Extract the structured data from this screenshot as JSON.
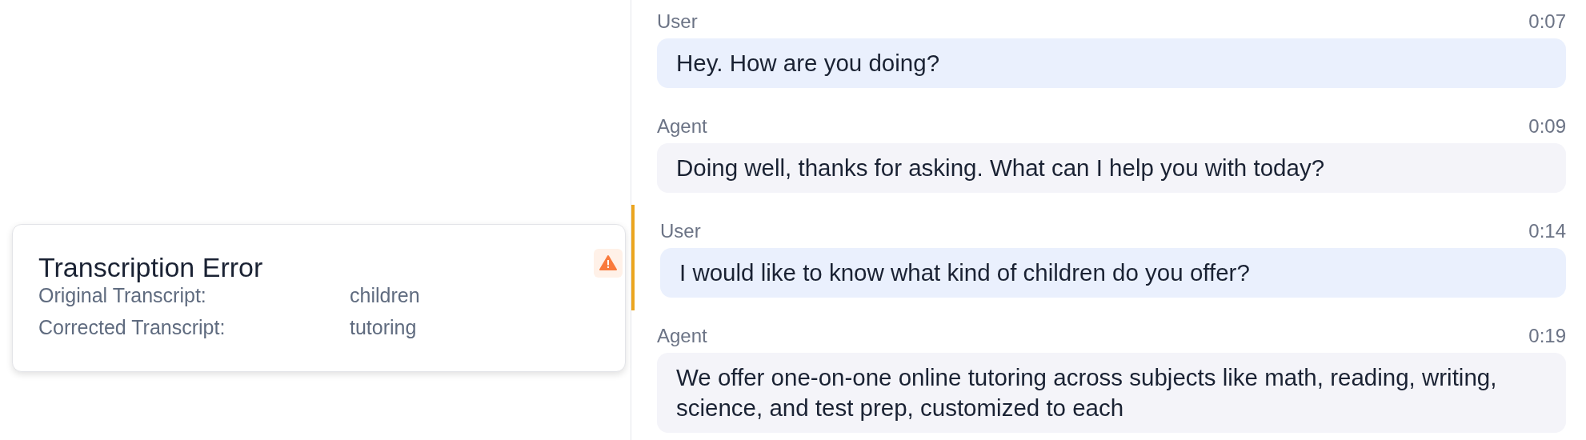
{
  "error_card": {
    "title": "Transcription Error",
    "rows": [
      {
        "label": "Original Transcript:",
        "value": "children"
      },
      {
        "label": "Corrected Transcript:",
        "value": "tutoring"
      }
    ]
  },
  "messages": [
    {
      "role": "User",
      "kind": "user",
      "time": "0:07",
      "text": "Hey. How are you doing?",
      "highlighted": false
    },
    {
      "role": "Agent",
      "kind": "agent",
      "time": "0:09",
      "text": "Doing well, thanks for asking. What can I help you with today?",
      "highlighted": false
    },
    {
      "role": "User",
      "kind": "user",
      "time": "0:14",
      "text": "I would like to know what kind of children do you offer?",
      "highlighted": true
    },
    {
      "role": "Agent",
      "kind": "agent",
      "time": "0:19",
      "text": "We offer one-on-one online tutoring across subjects like math, reading, writing, science, and test prep, customized to each",
      "highlighted": false
    }
  ]
}
